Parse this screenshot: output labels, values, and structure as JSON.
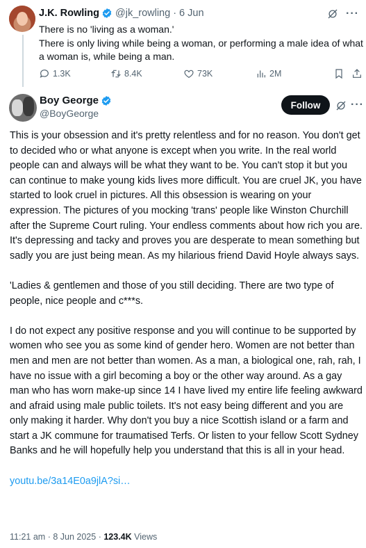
{
  "parent_tweet": {
    "author_name": "J.K. Rowling",
    "author_handle": "@jk_rowling",
    "separator": "·",
    "date": "6 Jun",
    "text_lines": [
      "There is no 'living as a woman.'",
      "There is only living while being a woman, or performing a male idea of what a woman is, while being a man."
    ],
    "stats": {
      "replies": "1.3K",
      "retweets": "8.4K",
      "likes": "73K",
      "views": "2M"
    }
  },
  "main_tweet": {
    "author_name": "Boy George",
    "author_handle": "@BoyGeorge",
    "follow_label": "Follow",
    "paragraphs": [
      "This is your obsession and it's pretty relentless and for no reason. You don't get to decided who or what anyone is except when you write. In the real world people can and always will be what they want to be. You can't stop it but you can continue to make young kids lives more difficult. You are cruel JK, you have started to look cruel in pictures. All this obsession is wearing on your expression. The pictures of you mocking 'trans' people like Winston Churchill after the Supreme Court ruling. Your endless comments about how rich you are. It's depressing and tacky and proves you are desperate to mean something but sadly you are just being mean. As my hilarious friend David Hoyle always says.",
      "'Ladies & gentlemen and those of you still deciding. There are two type of people, nice people and c***s.",
      "I do not expect any positive response and you will continue to be supported by women who see you as some kind of gender hero. Women are not better than men and men are not better than women. As a man, a biological one, rah, rah, I have no issue with a  girl becoming a boy or the other way around. As a gay man who has worn make-up since 14 I have lived my entire life feeling awkward and afraid using male public toilets. It's not easy being different and you are only making it harder. Why don't you buy a nice Scottish island or a farm and start a JK commune for traumatised Terfs. Or listen to your fellow Scott Sydney Banks and he will hopefully help you understand that this is all in your head."
    ],
    "link": "youtu.be/3a14E0a9jlA?si…",
    "time": "11:21 am",
    "separator": "·",
    "date": "8 Jun 2025",
    "views": "123.4K",
    "views_label": "Views"
  },
  "icons": {
    "verified": "verified-badge-icon",
    "grok": "grok-icon",
    "more": "more-icon",
    "reply": "reply-icon",
    "retweet": "retweet-icon",
    "like": "heart-icon",
    "views": "views-icon",
    "bookmark": "bookmark-icon",
    "share": "share-icon"
  },
  "colors": {
    "accent": "#1d9bf0",
    "text": "#0f1419",
    "secondary": "#536471",
    "follow_button": "#0f1419"
  }
}
